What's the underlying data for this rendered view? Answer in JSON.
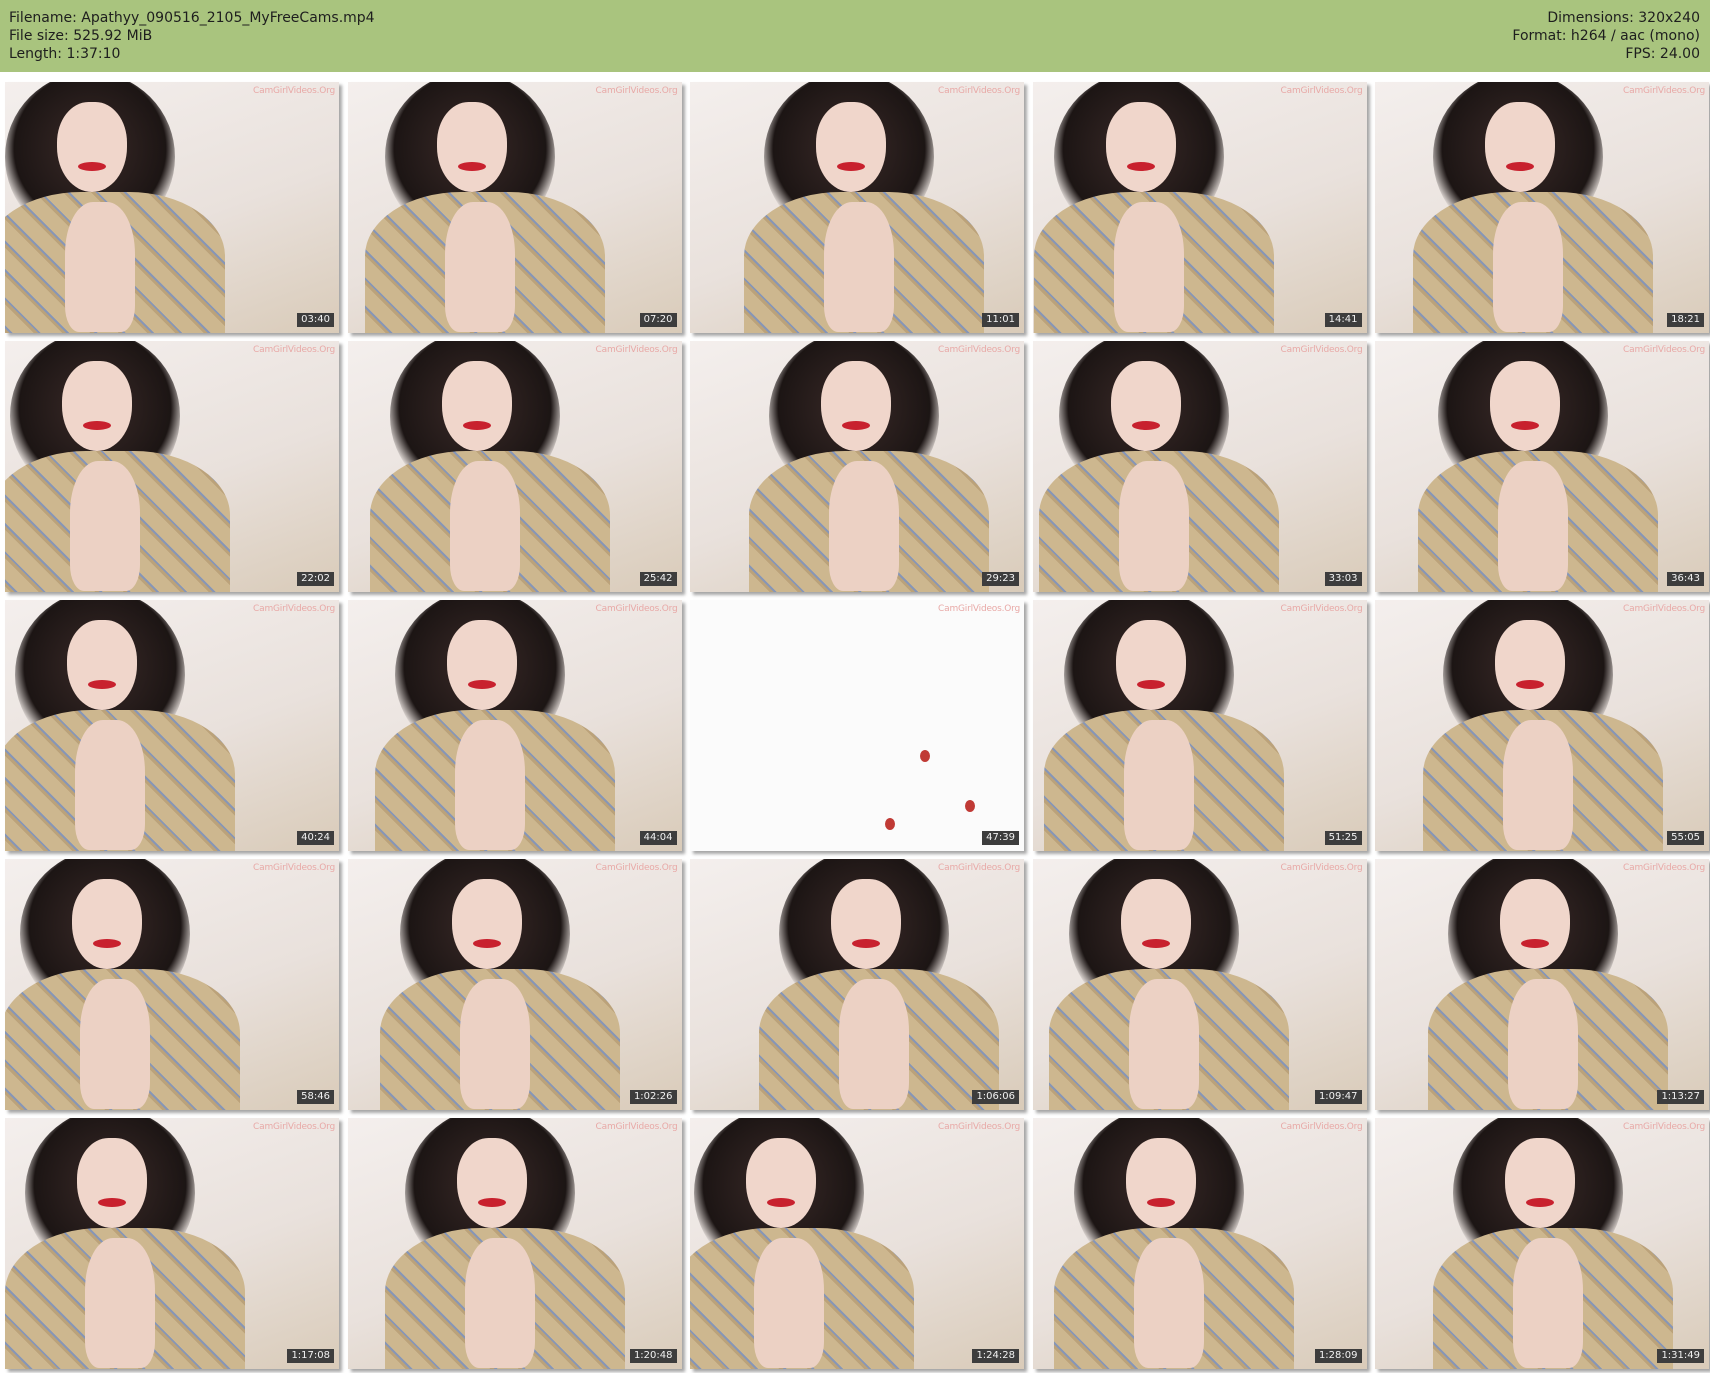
{
  "header": {
    "filename_line": "Filename: Apathyy_090516_2105_MyFreeCams.mp4",
    "filesize_line": "File size: 525.92 MiB",
    "length_line": "Length: 1:37:10",
    "dimensions_line": "Dimensions: 320x240",
    "format_line": "Format: h264 / aac (mono)",
    "fps_line": "FPS: 24.00"
  },
  "watermark": "CamGirlVideos.Org",
  "thumbnails": [
    {
      "time": "03:40"
    },
    {
      "time": "07:20"
    },
    {
      "time": "11:01"
    },
    {
      "time": "14:41"
    },
    {
      "time": "18:21"
    },
    {
      "time": "22:02"
    },
    {
      "time": "25:42"
    },
    {
      "time": "29:23"
    },
    {
      "time": "33:03"
    },
    {
      "time": "36:43"
    },
    {
      "time": "40:24"
    },
    {
      "time": "44:04"
    },
    {
      "time": "47:39"
    },
    {
      "time": "51:25"
    },
    {
      "time": "55:05"
    },
    {
      "time": "58:46"
    },
    {
      "time": "1:02:26"
    },
    {
      "time": "1:06:06"
    },
    {
      "time": "1:09:47"
    },
    {
      "time": "1:13:27"
    },
    {
      "time": "1:17:08"
    },
    {
      "time": "1:20:48"
    },
    {
      "time": "1:24:28"
    },
    {
      "time": "1:28:09"
    },
    {
      "time": "1:31:49"
    }
  ],
  "colors": {
    "header_bg": "#a9c47e",
    "timestamp_bg": "#3d3d3d",
    "watermark": "#e8a9a7"
  }
}
